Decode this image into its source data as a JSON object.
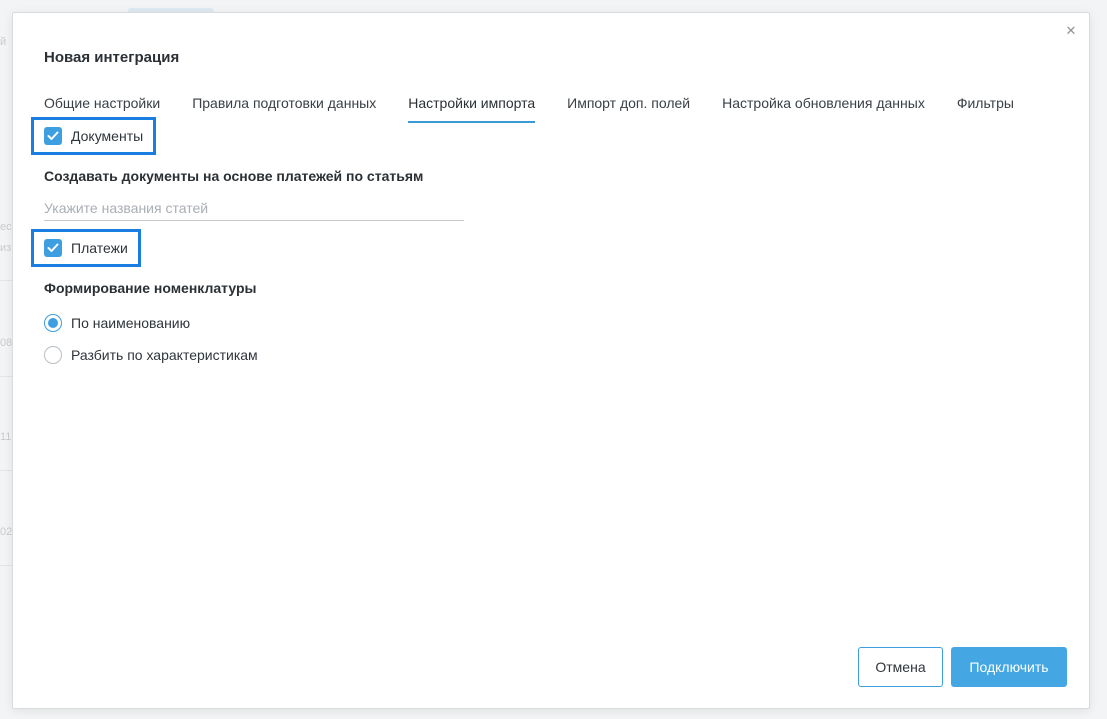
{
  "background": {
    "fragments": [
      "й",
      "ес",
      "из",
      "08",
      "11",
      "02"
    ]
  },
  "modal": {
    "title": "Новая интеграция",
    "close_icon": "close-icon",
    "tabs": [
      {
        "label": "Общие настройки",
        "active": false
      },
      {
        "label": "Правила подготовки данных",
        "active": false
      },
      {
        "label": "Настройки импорта",
        "active": true
      },
      {
        "label": "Импорт доп. полей",
        "active": false
      },
      {
        "label": "Настройка обновления данных",
        "active": false
      },
      {
        "label": "Фильтры",
        "active": false
      }
    ],
    "documents": {
      "label": "Документы",
      "checked": true
    },
    "create_docs": {
      "label": "Создавать документы на основе платежей по статьям",
      "value": "",
      "placeholder": "Укажите названия статей"
    },
    "payments": {
      "label": "Платежи",
      "checked": true
    },
    "nomenclature": {
      "label": "Формирование номенклатуры",
      "options": [
        {
          "label": "По наименованию",
          "selected": true
        },
        {
          "label": "Разбить по характеристикам",
          "selected": false
        }
      ]
    },
    "buttons": {
      "cancel": "Отмена",
      "connect": "Подключить"
    }
  },
  "colors": {
    "accent": "#3d9ee0",
    "highlight_border": "#1a7ee0",
    "primary_button": "#44a6e3"
  }
}
